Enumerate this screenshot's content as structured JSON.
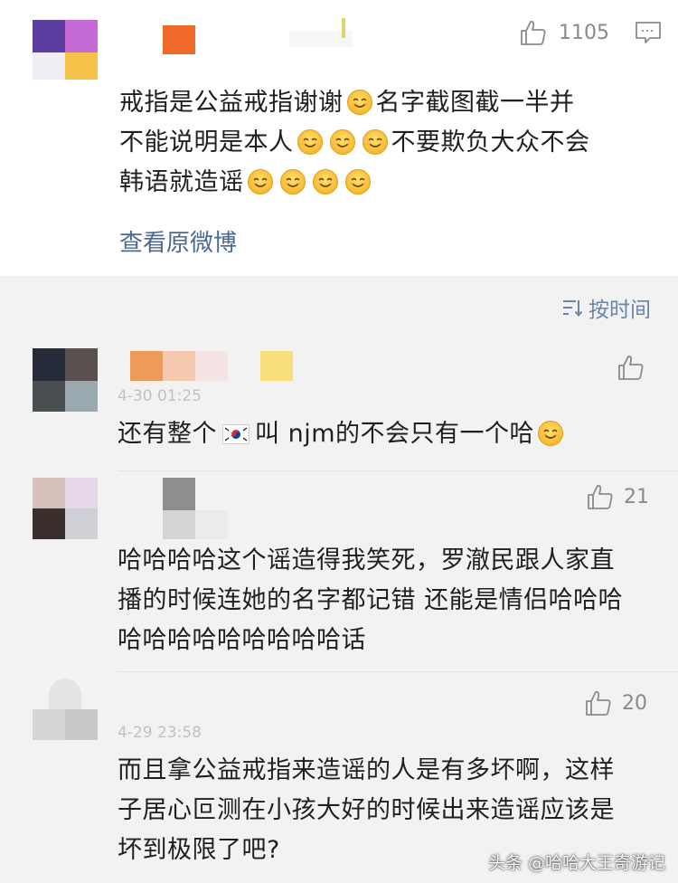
{
  "main": {
    "like_count": "1105",
    "text_line1": "戒指是公益戒指谢谢",
    "text_line1b": "名字截图截一半并",
    "text_line2a": "不能说明是本人",
    "text_line2b": "不要欺负大众不会",
    "text_line3": "韩语就造谣",
    "view_original": "查看原微博"
  },
  "sort_label": "按时间",
  "comments": [
    {
      "timestamp": "4-30 01:25",
      "text_a": "还有整个",
      "text_b": "叫 njm的不会只有一个哈"
    },
    {
      "like_count": "21",
      "line1": "哈哈哈哈这个谣造得我笑死，罗澈民跟人家直",
      "line2": "播的时候连她的名字都记错 还能是情侣哈哈哈",
      "line3": "哈哈哈哈哈哈哈哈哈话"
    },
    {
      "like_count": "20",
      "timestamp": "4-29 23:58",
      "line1": "而且拿公益戒指来造谣的人是有多坏啊，这样",
      "line2": "子居心叵测在小孩大好的时候出来造谣应该是",
      "line3": "坏到极限了吧?"
    }
  ],
  "watermark": "头条 @哈哈大王奇游记",
  "icons": {
    "like": "thumbs-up-icon",
    "comment": "comment-icon",
    "sort": "sort-icon",
    "emoji": "smiling-face-icon",
    "flag": "south-korea-flag-icon"
  },
  "colors": {
    "link": "#4a6a93",
    "sort": "#6b85a8",
    "icon": "#8a8a8a",
    "background": "#f2f2f2"
  }
}
